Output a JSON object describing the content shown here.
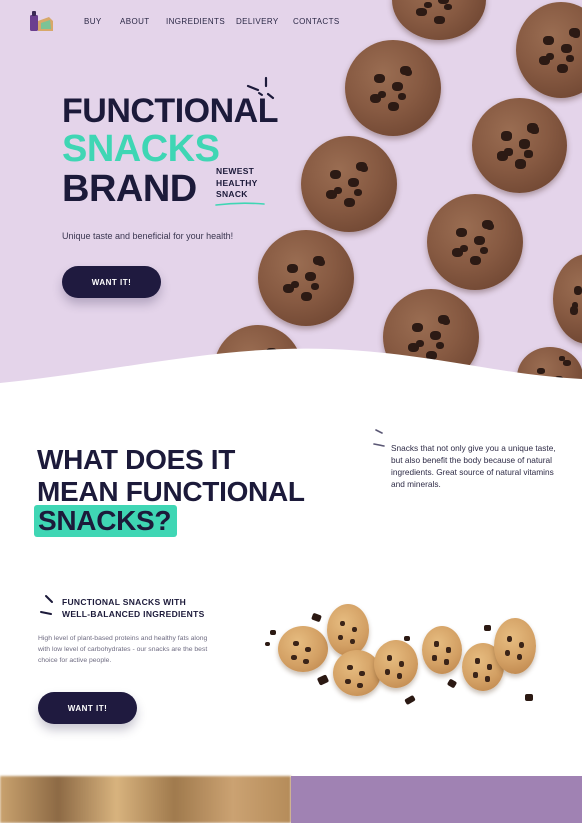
{
  "nav": {
    "items": [
      "BUY",
      "ABOUT",
      "INGREDIENTS",
      "DELIVERY",
      "CONTACTS"
    ]
  },
  "hero": {
    "title_line1": "FUNCTIONAL",
    "title_line2": "SNACKS",
    "title_line3": "BRAND",
    "badge_line1": "NEWEST",
    "badge_line2": "HEALTHY",
    "badge_line3": "SNACK",
    "tagline": "Unique taste and beneficial for your health!",
    "cta_label": "WANT IT!"
  },
  "about": {
    "heading_line1": "WHAT DOES IT",
    "heading_line2": "MEAN FUNCTIONAL",
    "heading_highlight": "SNACKS?",
    "side_text": "Snacks that not only give you a unique taste, but also benefit the body because of natural ingredients. Great source of natural vitamins and minerals."
  },
  "feature": {
    "title_line1": "FUNCTIONAL SNACKS WITH",
    "title_line2": "WELL-BALANCED INGREDIENTS",
    "body": "High level of plant-based proteins and healthy fats along with low level of carbohydrates - our snacks are the best choice for active people.",
    "cta_label": "WANT IT!"
  },
  "colors": {
    "hero_bg": "#e4d4ea",
    "accent": "#3fd6b4",
    "dark": "#1c1a3a",
    "button": "#1f1a3f",
    "purple_block": "#a082b3"
  },
  "icons": [
    "logo-icon",
    "sparkle-icon",
    "slash-decoration-icon"
  ]
}
